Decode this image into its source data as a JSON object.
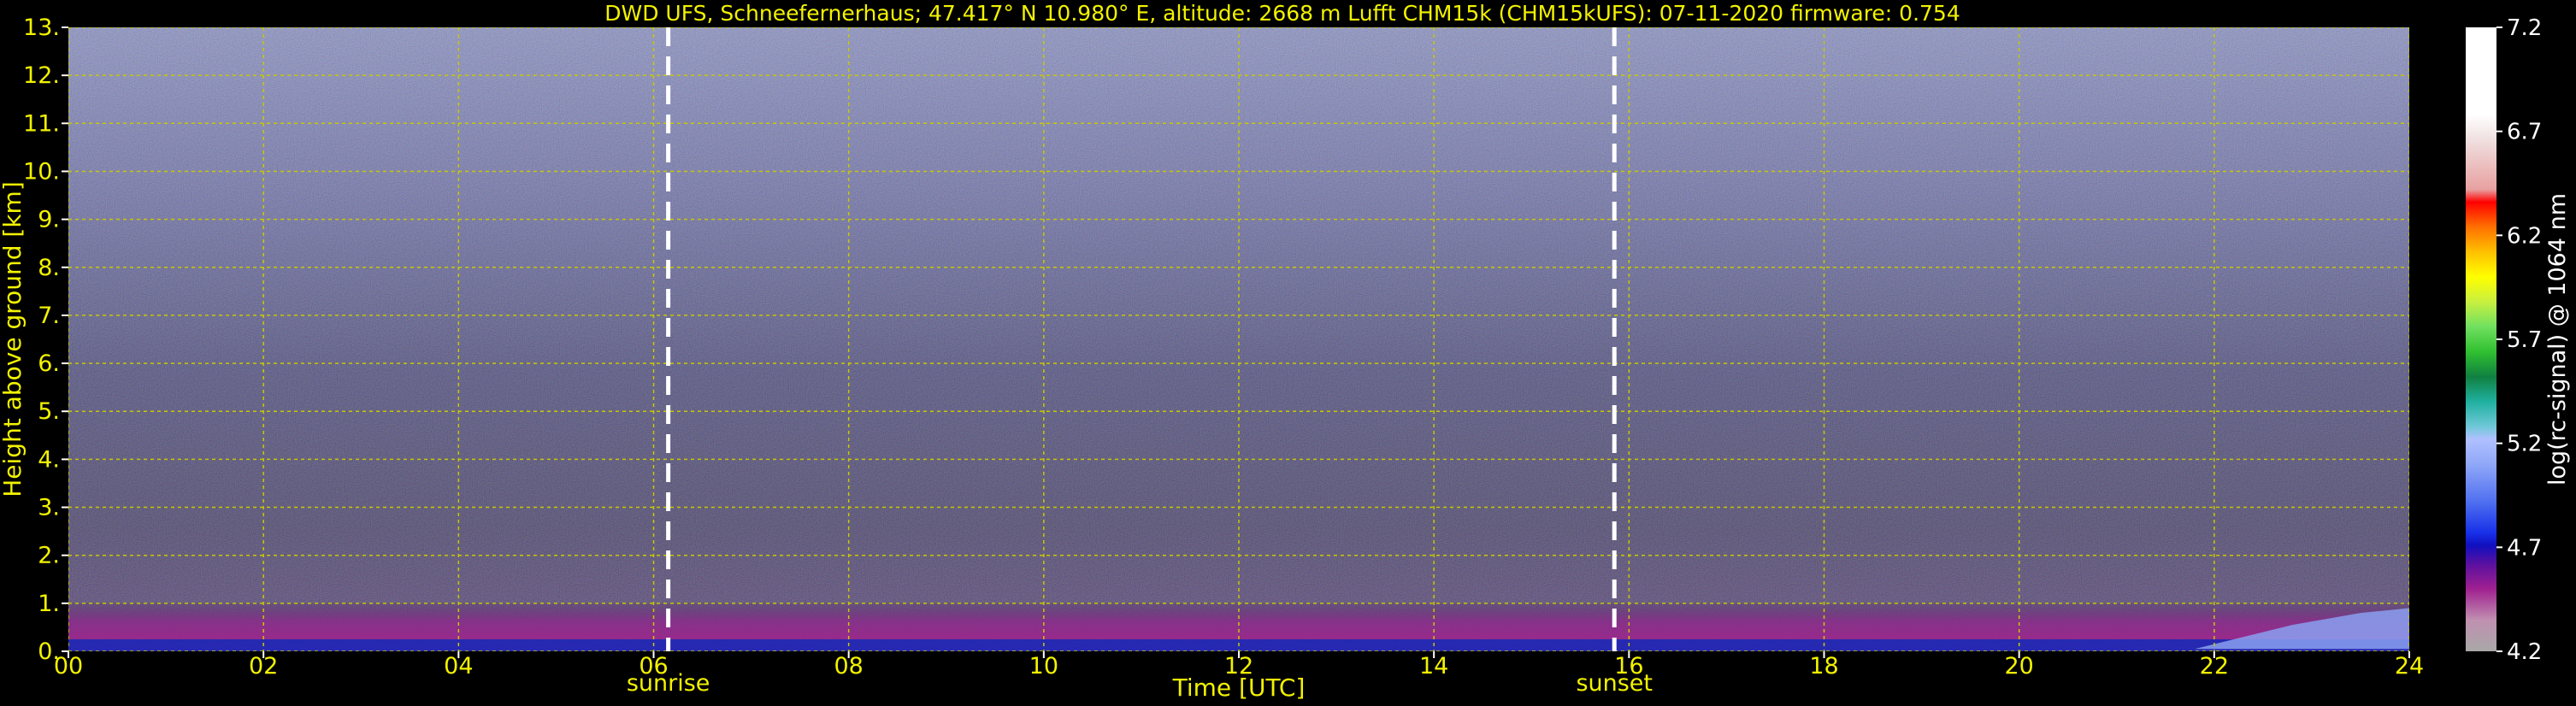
{
  "chart_data": {
    "type": "heatmap",
    "title": "DWD UFS, Schneefernerhaus; 47.417° N 10.980° E, altitude: 2668 m    Lufft CHM15k (CHM15kUFS): 07-11-2020    firmware: 0.754",
    "xlabel": "Time [UTC]",
    "ylabel": "Height above ground [km]",
    "xlim": [
      0,
      24
    ],
    "ylim": [
      0,
      13
    ],
    "x_ticks": [
      "00",
      "02",
      "04",
      "06",
      "08",
      "10",
      "12",
      "14",
      "16",
      "18",
      "20",
      "22",
      "24"
    ],
    "y_ticks": [
      "0.",
      "1.",
      "2.",
      "3.",
      "4.",
      "5.",
      "6.",
      "7.",
      "8.",
      "9.",
      "10.",
      "11.",
      "12.",
      "13."
    ],
    "grid": true,
    "events": [
      {
        "label": "sunrise",
        "x": 6.15
      },
      {
        "label": "sunset",
        "x": 15.85
      }
    ],
    "colorbar": {
      "label": "log(rc-signal) @ 1064 nm",
      "range": [
        4.2,
        7.2
      ],
      "ticks": [
        "4.2",
        "4.7",
        "5.2",
        "5.7",
        "6.2",
        "6.7",
        "7.2"
      ]
    },
    "layers": [
      {
        "height_km": [
          0.0,
          0.25
        ],
        "log_signal": 4.7,
        "note": "blue near-ground layer"
      },
      {
        "height_km": [
          0.25,
          1.0
        ],
        "log_signal": 4.4,
        "note": "purple/magenta boundary layer"
      },
      {
        "height_km": [
          1.0,
          13.0
        ],
        "log_signal": 4.3,
        "note": "noisy background"
      }
    ]
  },
  "colors": {
    "axis_text": "#f2f200",
    "grid": "#c8c800",
    "event_line": "#ffffff",
    "background": "#000000"
  }
}
